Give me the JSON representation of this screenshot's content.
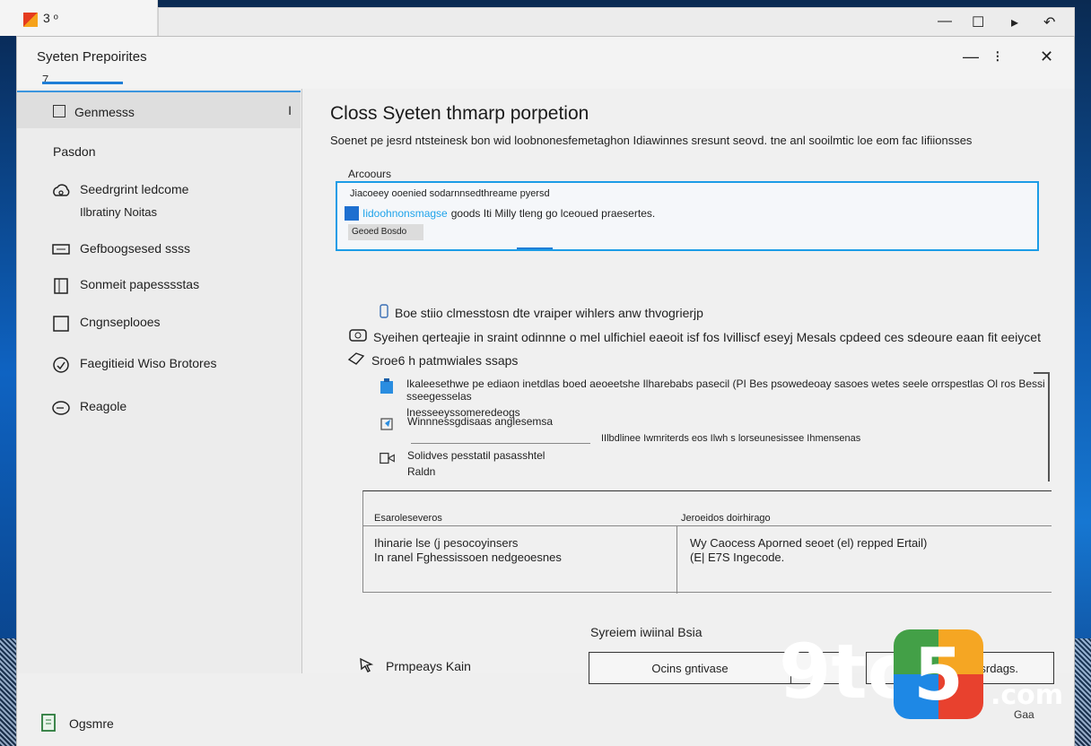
{
  "taskbar": {
    "app_label": "3 ᵒ"
  },
  "back_window": {
    "ctrl_min": "—",
    "ctrl_max": "☐",
    "ctrl_x": "▸",
    "ctrl_extra": "↶"
  },
  "dialog": {
    "title": "Syeten Prepoirites",
    "title_mark": "7",
    "ctrl_min": "—",
    "ctrl_mid": "⁝",
    "ctrl_close": "✕"
  },
  "sidebar": {
    "selected": {
      "label": "Genmesss",
      "cursor": "I"
    },
    "heading": "Pasdon",
    "items": [
      {
        "icon": "cloud-settings-icon",
        "label": "Seedrgrint ledcome",
        "sub": "Ilbratiny Noitas"
      },
      {
        "icon": "monitor-icon",
        "label": "Gefboogsesed ssss",
        "sub": ""
      },
      {
        "icon": "panel-icon",
        "label": "Sonmeit papesssstas",
        "sub": ""
      },
      {
        "icon": "square-icon",
        "label": "Cngnseplooes",
        "sub": ""
      },
      {
        "icon": "shield-icon",
        "label": "Faegitieid Wiso Brotores",
        "sub": ""
      },
      {
        "icon": "circle-arrow-icon",
        "label": "Reagole",
        "sub": ""
      }
    ],
    "bottom": {
      "label": "Ogsmre"
    }
  },
  "content": {
    "title": "Closs Syeten thmarp porpetion",
    "description": "Soenet pe jesrd ntsteinesk bon wid loobnonesfemetaghon Idiawinnes sresunt seovd. tne anl sooilmtic loe eom fac Iifiionsses",
    "accounts": {
      "label": "Arcoours",
      "line1": "Jiacoeey ooenied sodarnnsedthreame pyersd",
      "line2_highlight": "Iidoohnonsmagse",
      "line2_rest": "goods Iti Milly tleng go lceoued praesertes.",
      "button": "Geoed Bosdo"
    },
    "row1": "Boe stiio clmesstosn dte vraiper wihlers anw thvogrierjp",
    "row2": "Syeihen qerteajie in sraint odinnne o mel ulfichiel eaeoit isf fos Ivilliscf eseyj Mesals cpdeed ces sdeoure eaan fit eeiycet",
    "row3": "Sroe6 h patmwiales ssaps",
    "list": [
      {
        "icon": "clipboard-icon",
        "label": "Ikaleesethwe pe ediaon inetdlas boed aeoeetshe Ilharebabs pasecil (PI Bes psowedeoay sasoes wetes seele orrspestlas Ol ros Bessi sseegesselas",
        "sub": "Inesseeyssomeredeogs"
      },
      {
        "icon": "paper-plane-icon",
        "label": "Winnnessgdisaas anglesemsa",
        "sub": ""
      },
      {
        "icon": "drive-icon",
        "label": "Solidves pesstatil pasasshtel",
        "sub": "Raldn"
      }
    ],
    "list_aside": "IIlbdlinee Iwmriterds eos Ilwh s lorseunesissee Ihmensenas",
    "grid": {
      "header_left": "Esaroleseveros",
      "header_right": "Jeroeidos doirhirago",
      "cell_left_1": "Ihinarie lse (j pesocoyinsers",
      "cell_left_2": "In ranel Fghessissoen nedgeoesnes",
      "cell_right_1": "Wy Caocess Aporned seoet (el) repped Ertail)",
      "cell_right_2": "(E| E7S Ingecode."
    },
    "status_caption": "Syreiem iwiinal Bsia",
    "link": "Prmpeays Kain",
    "button1": "Ocins gntivase",
    "button2": "Sooneeds tepesrdags."
  },
  "watermark": {
    "nine": "9to",
    "five": "5",
    "com": ".com",
    "under": "Gaa"
  }
}
